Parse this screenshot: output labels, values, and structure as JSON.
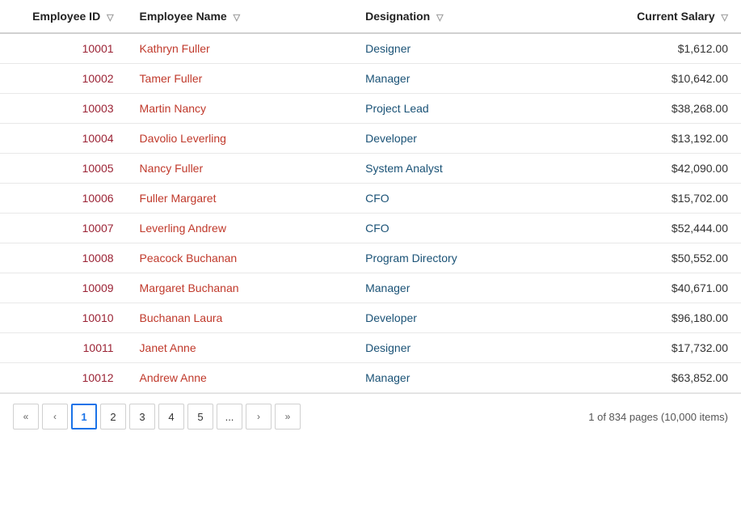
{
  "table": {
    "columns": [
      {
        "id": "employee_id",
        "label": "Employee ID",
        "filter": true,
        "align": "right"
      },
      {
        "id": "employee_name",
        "label": "Employee Name",
        "filter": true,
        "align": "left"
      },
      {
        "id": "designation",
        "label": "Designation",
        "filter": true,
        "align": "left"
      },
      {
        "id": "current_salary",
        "label": "Current Salary",
        "filter": true,
        "align": "right"
      }
    ],
    "rows": [
      {
        "id": "10001",
        "name": "Kathryn Fuller",
        "designation": "Designer",
        "salary": "$1,612.00"
      },
      {
        "id": "10002",
        "name": "Tamer Fuller",
        "designation": "Manager",
        "salary": "$10,642.00"
      },
      {
        "id": "10003",
        "name": "Martin Nancy",
        "designation": "Project Lead",
        "salary": "$38,268.00"
      },
      {
        "id": "10004",
        "name": "Davolio Leverling",
        "designation": "Developer",
        "salary": "$13,192.00"
      },
      {
        "id": "10005",
        "name": "Nancy Fuller",
        "designation": "System Analyst",
        "salary": "$42,090.00"
      },
      {
        "id": "10006",
        "name": "Fuller Margaret",
        "designation": "CFO",
        "salary": "$15,702.00"
      },
      {
        "id": "10007",
        "name": "Leverling Andrew",
        "designation": "CFO",
        "salary": "$52,444.00"
      },
      {
        "id": "10008",
        "name": "Peacock Buchanan",
        "designation": "Program Directory",
        "salary": "$50,552.00"
      },
      {
        "id": "10009",
        "name": "Margaret Buchanan",
        "designation": "Manager",
        "salary": "$40,671.00"
      },
      {
        "id": "10010",
        "name": "Buchanan Laura",
        "designation": "Developer",
        "salary": "$96,180.00"
      },
      {
        "id": "10011",
        "name": "Janet Anne",
        "designation": "Designer",
        "salary": "$17,732.00"
      },
      {
        "id": "10012",
        "name": "Andrew Anne",
        "designation": "Manager",
        "salary": "$63,852.00"
      }
    ]
  },
  "pagination": {
    "pages": [
      "1",
      "2",
      "3",
      "4",
      "5",
      "..."
    ],
    "current": "1",
    "info": "1 of 834 pages (10,000 items)",
    "prev_first": "«",
    "prev": "‹",
    "next": "›",
    "next_last": "»"
  }
}
